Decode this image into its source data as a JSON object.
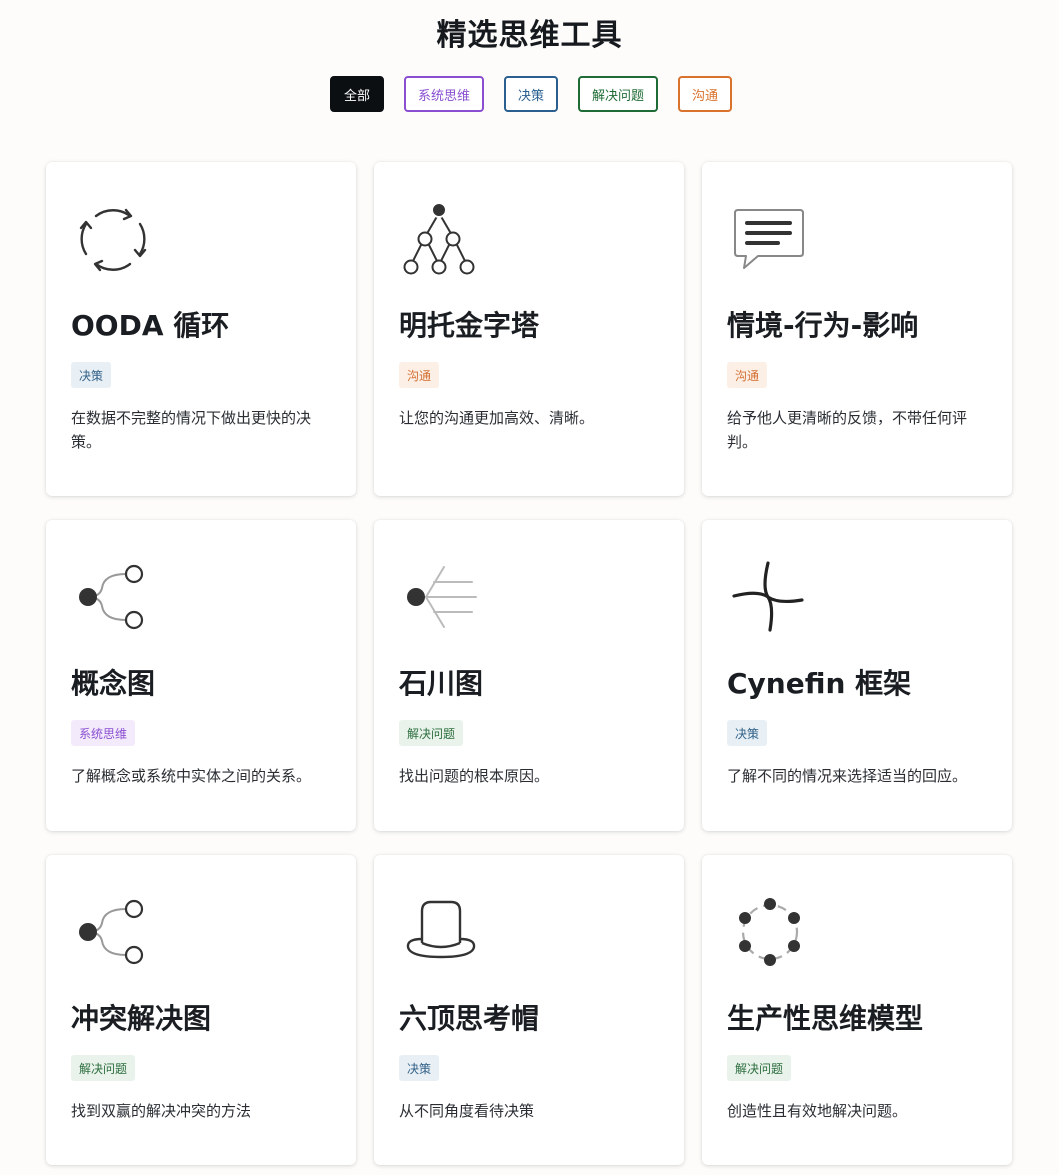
{
  "page": {
    "title": "精选思维工具"
  },
  "filters": [
    {
      "label": "全部",
      "active": true,
      "color": "#0c0f12"
    },
    {
      "label": "系统思维",
      "color": "#8a4fd0"
    },
    {
      "label": "决策",
      "color": "#2a5f8f"
    },
    {
      "label": "解决问题",
      "color": "#1f6b35"
    },
    {
      "label": "沟通",
      "color": "#d9722b"
    }
  ],
  "tag_styles": {
    "决策": {
      "fg": "#2f5f86",
      "bg": "#e8f0f6"
    },
    "沟通": {
      "fg": "#d47133",
      "bg": "#fcefe6"
    },
    "系统思维": {
      "fg": "#8a4fd0",
      "bg": "#f3ebfb"
    },
    "解决问题": {
      "fg": "#2b6d3d",
      "bg": "#e9f3eb"
    }
  },
  "cards": [
    {
      "icon": "ooda-cycle-icon",
      "title": "OODA 循环",
      "tag": "决策",
      "desc": "在数据不完整的情况下做出更快的决策。"
    },
    {
      "icon": "pyramid-tree-icon",
      "title": "明托金字塔",
      "tag": "沟通",
      "desc": "让您的沟通更加高效、清晰。"
    },
    {
      "icon": "speech-bubble-icon",
      "title": "情境-行为-影响",
      "tag": "沟通",
      "desc": "给予他人更清晰的反馈，不带任何评判。"
    },
    {
      "icon": "concept-map-icon",
      "title": "概念图",
      "tag": "系统思维",
      "desc": "了解概念或系统中实体之间的关系。"
    },
    {
      "icon": "fishbone-icon",
      "title": "石川图",
      "tag": "解决问题",
      "desc": "找出问题的根本原因。"
    },
    {
      "icon": "cynefin-icon",
      "title": "Cynefin 框架",
      "tag": "决策",
      "desc": "了解不同的情况来选择适当的回应。"
    },
    {
      "icon": "conflict-map-icon",
      "title": "冲突解决图",
      "tag": "解决问题",
      "desc": "找到双赢的解决冲突的方法"
    },
    {
      "icon": "top-hat-icon",
      "title": "六顶思考帽",
      "tag": "决策",
      "desc": "从不同角度看待决策"
    },
    {
      "icon": "dot-circle-icon",
      "title": "生产性思维模型",
      "tag": "解决问题",
      "desc": "创造性且有效地解决问题。"
    }
  ]
}
